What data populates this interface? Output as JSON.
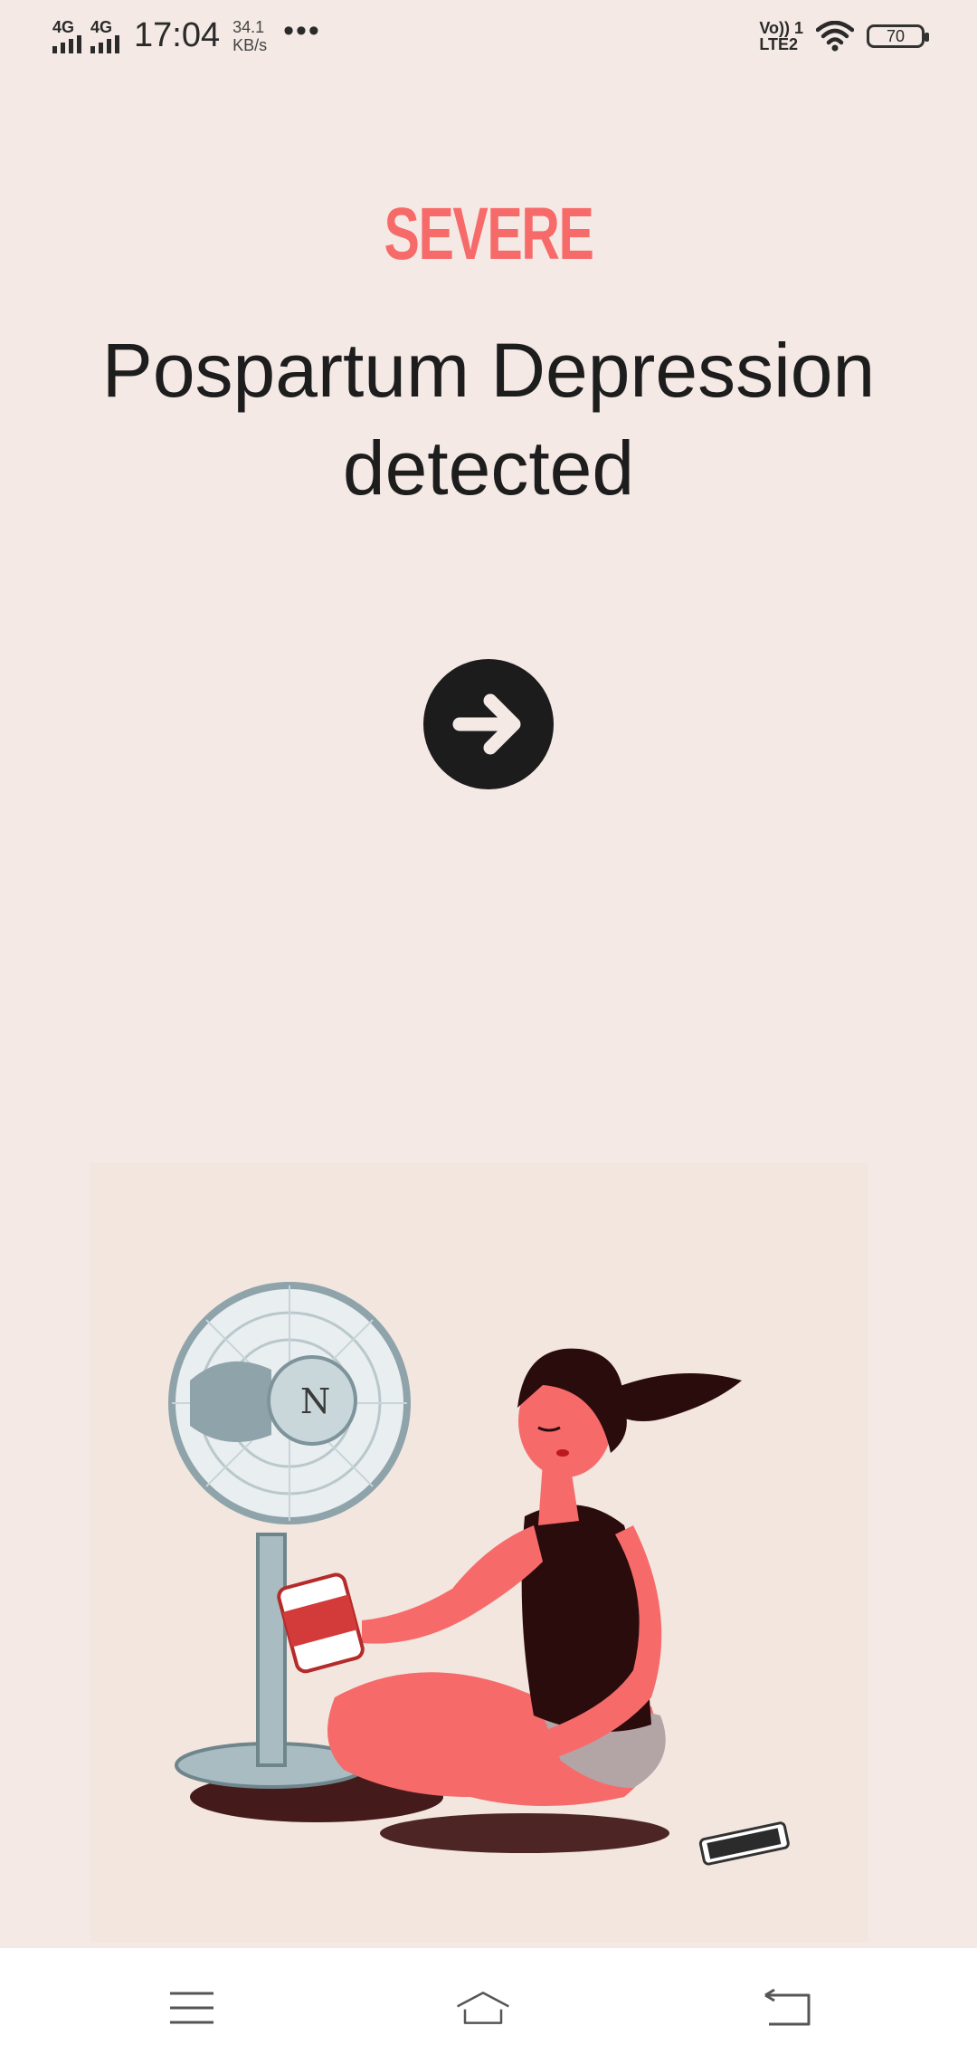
{
  "status_bar": {
    "network1": "4G",
    "network2": "4G",
    "time": "17:04",
    "speed_value": "34.1",
    "speed_unit": "KB/s",
    "more": "•••",
    "volte_line1": "Vo)) 1",
    "volte_line2": "LTE2",
    "battery": "70"
  },
  "result": {
    "severity": "SEVERE",
    "headline": "Pospartum Depression detected"
  },
  "icons": {
    "next": "arrow-right-icon",
    "wifi": "wifi-icon",
    "menu": "menu-icon",
    "home": "home-icon",
    "back": "back-icon"
  },
  "colors": {
    "background": "#f4e9e4",
    "severity": "#f76a6a",
    "button": "#1c1c1c",
    "nav_bar": "#ffffff"
  }
}
